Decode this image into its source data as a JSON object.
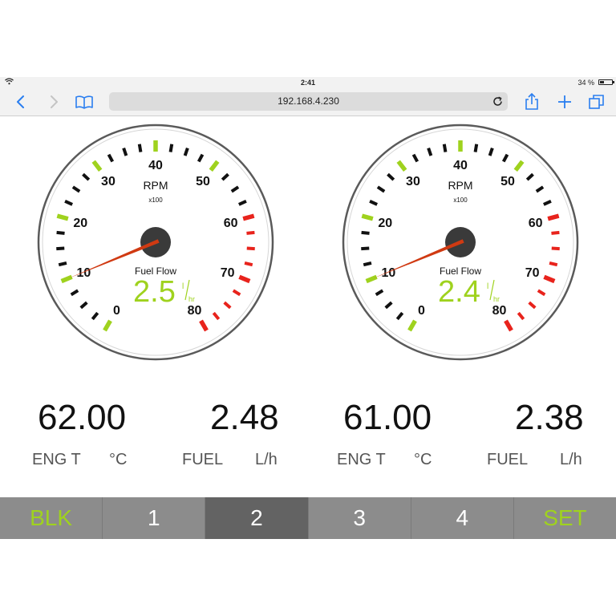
{
  "status_bar": {
    "time": "2:41",
    "battery": "34 %"
  },
  "browser": {
    "url": "192.168.4.230"
  },
  "gauges": [
    {
      "scale_labels": [
        "0",
        "10",
        "20",
        "30",
        "40",
        "50",
        "60",
        "70",
        "80"
      ],
      "title": "RPM",
      "multiplier": "x100",
      "fuel_flow_label": "Fuel Flow",
      "fuel_flow_value": "2.5",
      "fuel_flow_unit_top": "l",
      "fuel_flow_unit_bottom": "hr",
      "rpm_value": 10
    },
    {
      "scale_labels": [
        "0",
        "10",
        "20",
        "30",
        "40",
        "50",
        "60",
        "70",
        "80"
      ],
      "title": "RPM",
      "multiplier": "x100",
      "fuel_flow_label": "Fuel Flow",
      "fuel_flow_value": "2.4",
      "fuel_flow_unit_top": "l",
      "fuel_flow_unit_bottom": "hr",
      "rpm_value": 10
    }
  ],
  "readouts": [
    {
      "value": "62.00",
      "label": "ENG T",
      "unit": "°C"
    },
    {
      "value": "2.48",
      "label": "FUEL",
      "unit": "L/h"
    },
    {
      "value": "61.00",
      "label": "ENG T",
      "unit": "°C"
    },
    {
      "value": "2.38",
      "label": "FUEL",
      "unit": "L/h"
    }
  ],
  "tabs": [
    {
      "label": "BLK",
      "active": false,
      "accent": true
    },
    {
      "label": "1",
      "active": false,
      "accent": false
    },
    {
      "label": "2",
      "active": true,
      "accent": false
    },
    {
      "label": "3",
      "active": false,
      "accent": false
    },
    {
      "label": "4",
      "active": false,
      "accent": false
    },
    {
      "label": "SET",
      "active": false,
      "accent": true
    }
  ],
  "colors": {
    "accent_green": "#9fd21e",
    "redline": "#e8231c",
    "tick": "#111111",
    "needle": "#d03a12",
    "tab_bg": "#8c8c8c",
    "tab_active_bg": "#636363"
  },
  "icons": [
    "wifi-icon",
    "battery-icon",
    "back-icon",
    "forward-icon",
    "bookmarks-icon",
    "reload-icon",
    "share-icon",
    "new-tab-icon",
    "tabs-icon"
  ]
}
